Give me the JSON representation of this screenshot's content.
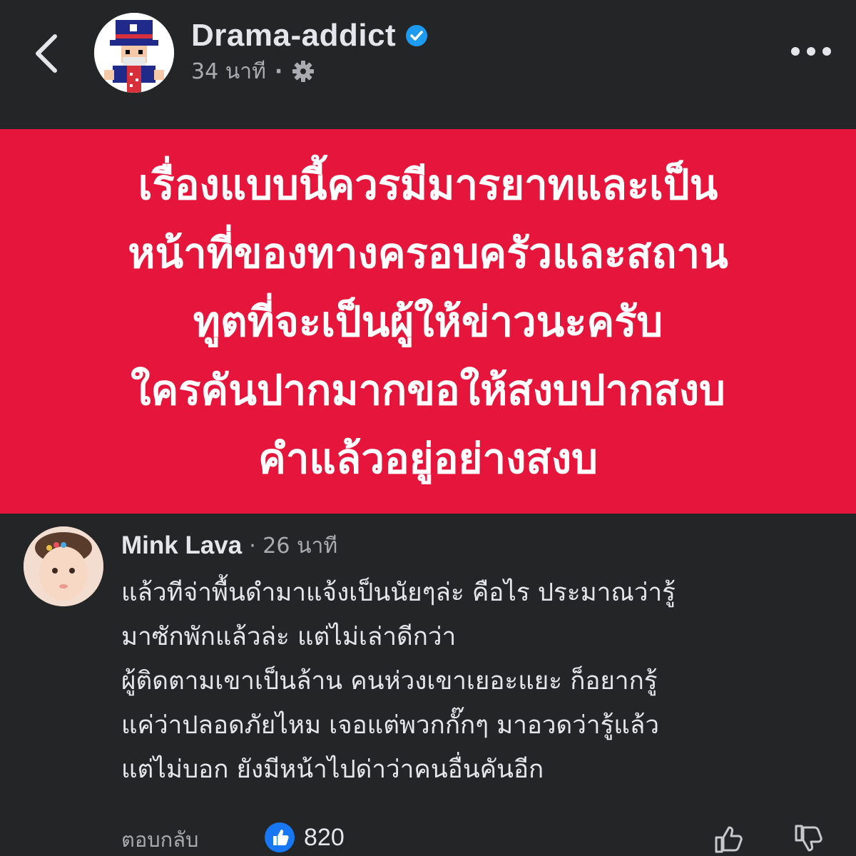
{
  "header": {
    "page_name": "Drama-addict",
    "time": "34 นาที",
    "separator": "·",
    "verified_color": "#1d9bf0"
  },
  "post": {
    "banner_color": "#e5153b",
    "lines": [
      "เรื่องแบบนี้ควรมีมารยาทและเป็น",
      "หน้าที่ของทางครอบครัวและสถาน",
      "ทูตที่จะเป็นผู้ให้ข่าวนะครับ",
      "ใครคันปากมากขอให้สงบปากสงบ",
      "คำแล้วอยู่อย่างสงบ"
    ]
  },
  "comment": {
    "author": "Mink Lava",
    "time": "· 26 นาที",
    "lines": [
      "แล้วทีจ่าพื้นดำมาแจ้งเป็นนัยๆล่ะ คือไร ประมาณว่ารู้",
      "มาซักพักแล้วล่ะ แต่ไม่เล่าดีกว่า",
      "ผู้ติดตามเขาเป็นล้าน คนห่วงเขาเยอะแยะ ก็อยากรู้",
      "แค่ว่าปลอดภัยไหม เจอแต่พวกกั๊กๆ มาอวดว่ารู้แล้ว",
      "แต่ไม่บอก ยังมีหน้าไปด่าว่าคนอื่นคันอีก"
    ],
    "reply_label": "ตอบกลับ",
    "reaction_count": "820",
    "like_color": "#1877f2"
  },
  "icons": {
    "back": "chevron-left-icon",
    "settings": "gear-icon",
    "more": "more-dots-icon",
    "verified": "verified-badge-icon",
    "like": "like-reaction-icon",
    "thumb_up": "thumbs-up-icon",
    "thumb_down": "thumbs-down-icon"
  }
}
